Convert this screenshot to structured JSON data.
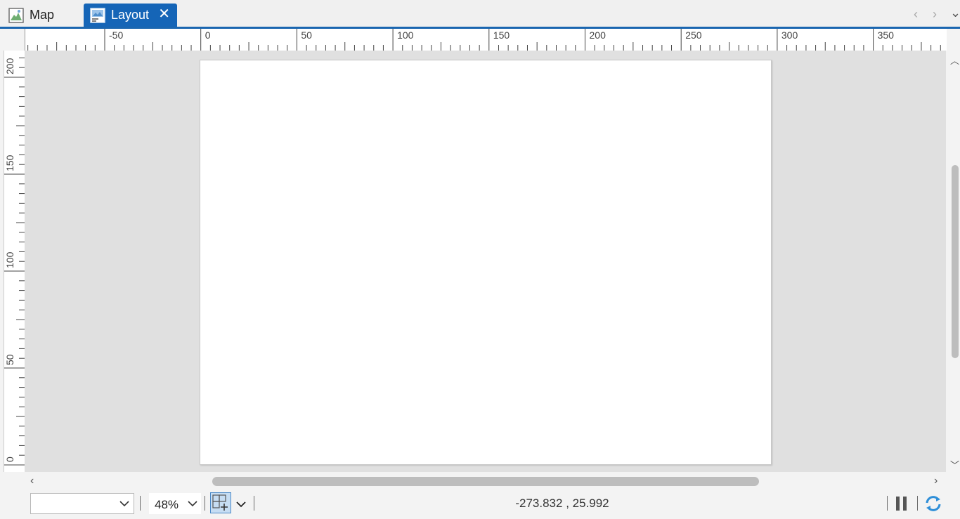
{
  "tabs": [
    {
      "label": "Map",
      "active": false,
      "icon": "map-icon"
    },
    {
      "label": "Layout",
      "active": true,
      "icon": "layout-icon"
    }
  ],
  "tab_close_glyph": "✕",
  "tab_nav": {
    "prev": "‹",
    "next": "›",
    "menu": "⌄"
  },
  "rulers": {
    "horizontal_labels": [
      "-50",
      "0",
      "50",
      "100",
      "150",
      "200",
      "250",
      "300",
      "350"
    ],
    "vertical_labels": [
      "200",
      "150",
      "100",
      "50",
      "0"
    ]
  },
  "status": {
    "scale_value": "",
    "zoom": "48%",
    "coordinates": "-273.832 , 25.992"
  },
  "colors": {
    "accent": "#1565b7",
    "canvas": "#e0e0e0",
    "page": "#ffffff",
    "refresh": "#2f8fd8"
  },
  "icons": [
    "map-icon",
    "layout-icon",
    "close-icon",
    "chevron-left-icon",
    "chevron-right-icon",
    "chevron-down-icon",
    "snap-grid-icon",
    "pause-icon",
    "refresh-icon"
  ]
}
